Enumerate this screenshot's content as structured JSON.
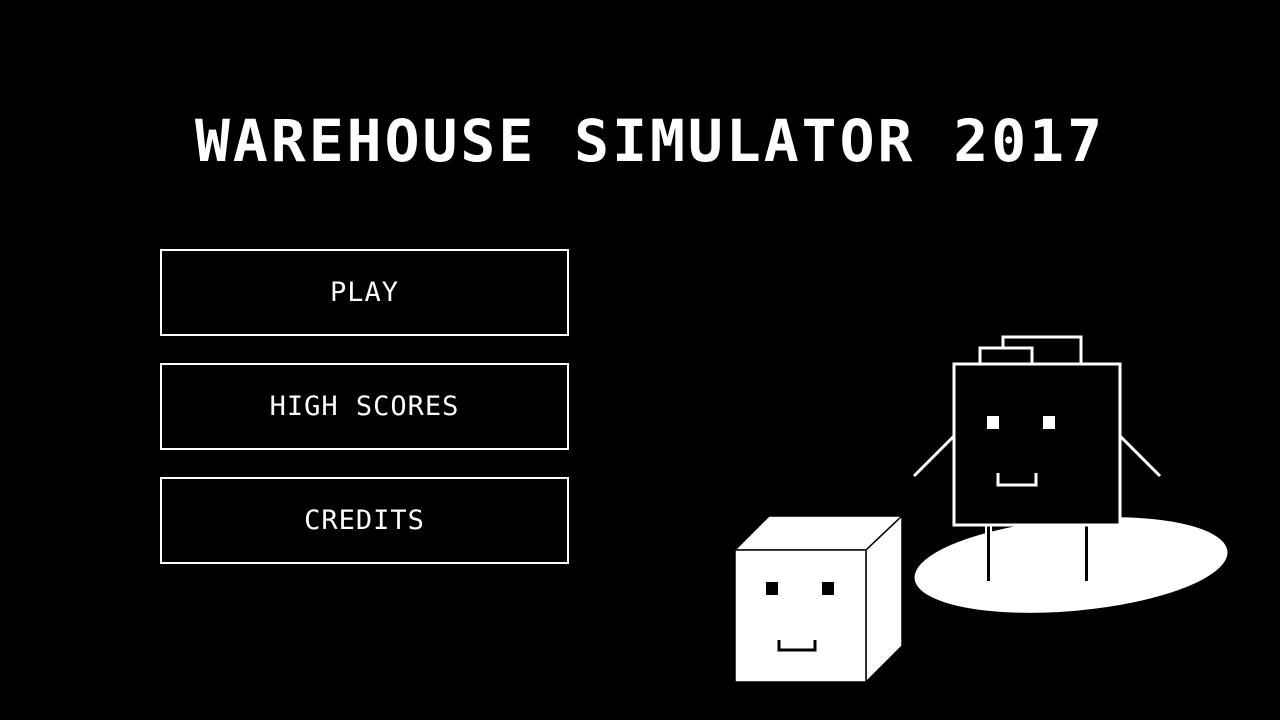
{
  "game": {
    "title": "WAREHOUSE SIMULATOR 2017"
  },
  "menu": {
    "items": [
      {
        "label": "PLAY"
      },
      {
        "label": "HIGH SCORES"
      },
      {
        "label": "CREDITS"
      }
    ]
  },
  "colors": {
    "background": "#000000",
    "foreground": "#ffffff"
  }
}
